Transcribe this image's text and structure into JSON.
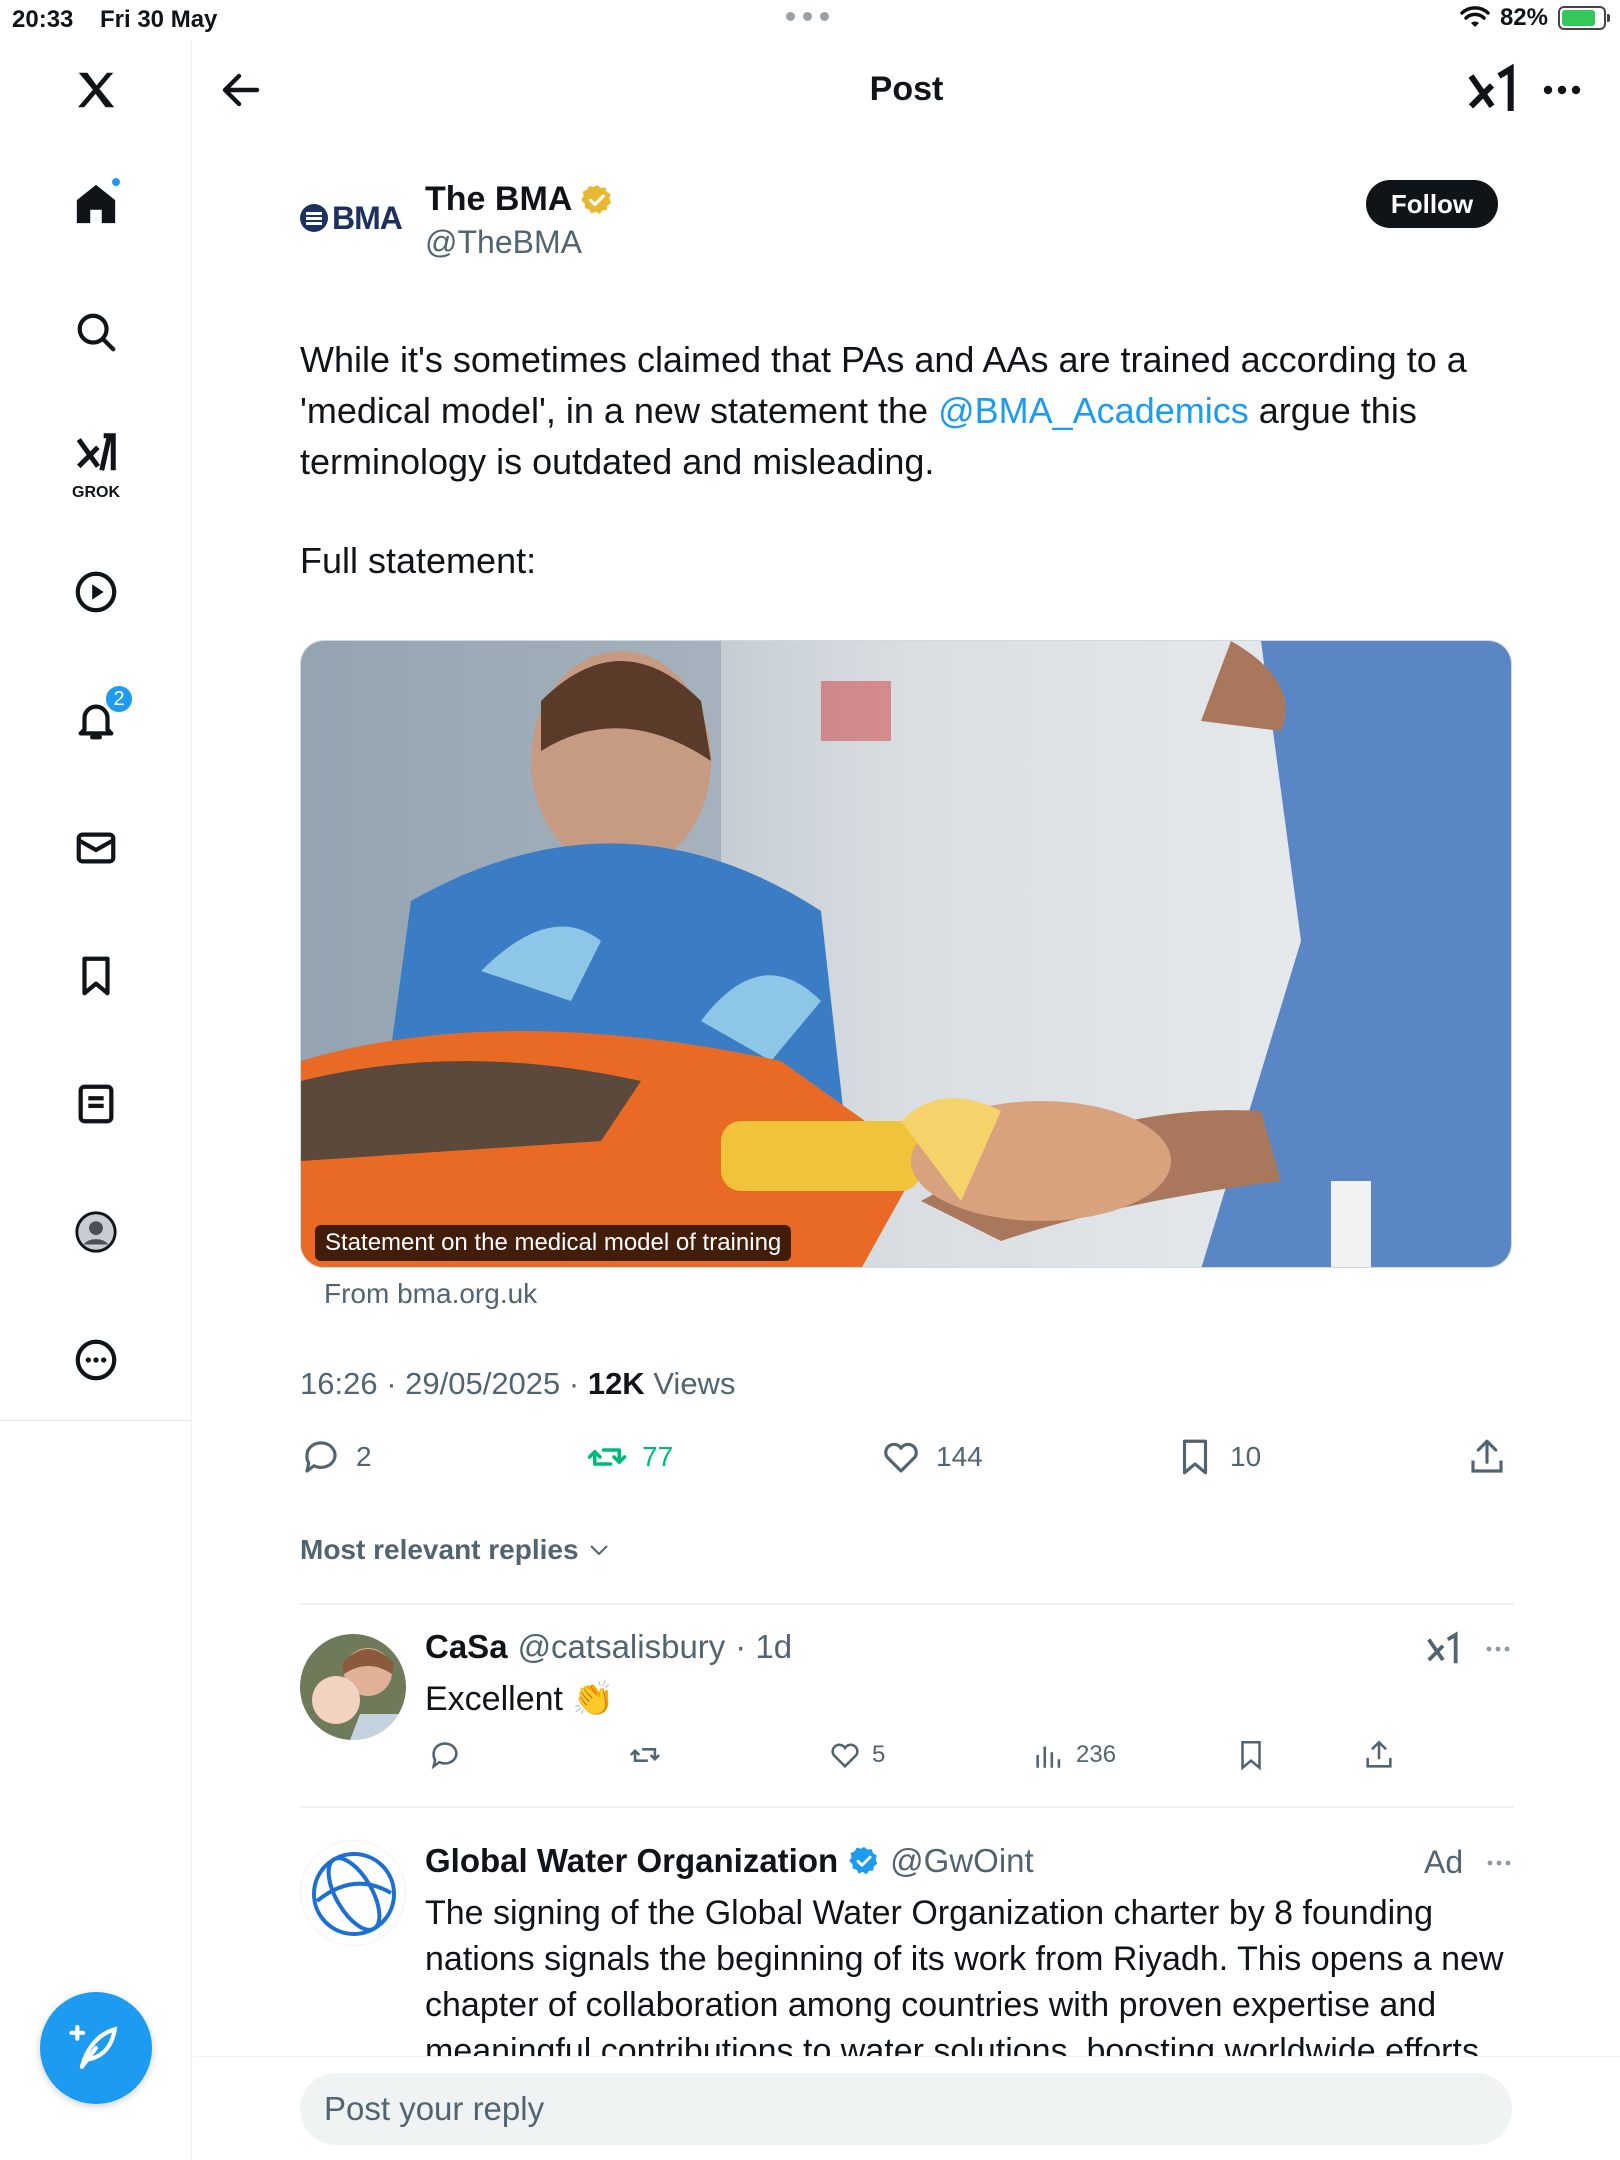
{
  "status_bar": {
    "time": "20:33",
    "date": "Fri 30 May",
    "battery": "82%",
    "battery_level": 0.82
  },
  "sidebar": {
    "items": [
      {
        "icon": "home-icon"
      },
      {
        "icon": "search-icon"
      },
      {
        "icon": "grok-icon",
        "label": "GROK"
      },
      {
        "icon": "video-icon"
      },
      {
        "icon": "bell-icon",
        "badge": "2"
      },
      {
        "icon": "mail-icon"
      },
      {
        "icon": "bookmark-icon"
      },
      {
        "icon": "list-icon"
      },
      {
        "icon": "profile-icon"
      },
      {
        "icon": "more-icon"
      }
    ]
  },
  "header": {
    "title": "Post"
  },
  "post": {
    "logo_text": "BMA",
    "author_name": "The BMA",
    "author_handle": "@TheBMA",
    "follow_label": "Follow",
    "text_before": "While it's sometimes claimed that PAs and AAs are trained according to a 'medical model', in a new statement the ",
    "mention": "@BMA_Academics",
    "text_after": " argue this terminology is outdated and misleading.",
    "text2": "Full statement:",
    "card_caption": "Statement on the medical model of training",
    "card_source": "From bma.org.uk",
    "timestamp": "16:26 · 29/05/2025 · ",
    "views_count": "12K",
    "views_label": " Views",
    "stats": {
      "replies": "2",
      "reposts": "77",
      "likes": "144",
      "bookmarks": "10"
    }
  },
  "sort_label": "Most relevant replies",
  "replies": [
    {
      "name": "CaSa",
      "handle": "@catsalisbury",
      "age": "· 1d",
      "text": "Excellent 👏",
      "likes": "5",
      "views": "236"
    },
    {
      "name": "Global Water Organization",
      "handle": "@GwOint",
      "ad_label": "Ad",
      "text": "The signing of the Global Water Organization charter by 8 founding nations signals the beginning of its work from Riyadh. This opens a new chapter of collaboration among countries with proven expertise and meaningful contributions to water solutions, boosting worldwide efforts"
    }
  ],
  "reply_input": {
    "placeholder": "Post your reply"
  },
  "colors": {
    "accent": "#1d9bf0",
    "repost_green": "#00ba7c",
    "gold_badge": "#e8b830",
    "text_secondary": "#536471"
  }
}
